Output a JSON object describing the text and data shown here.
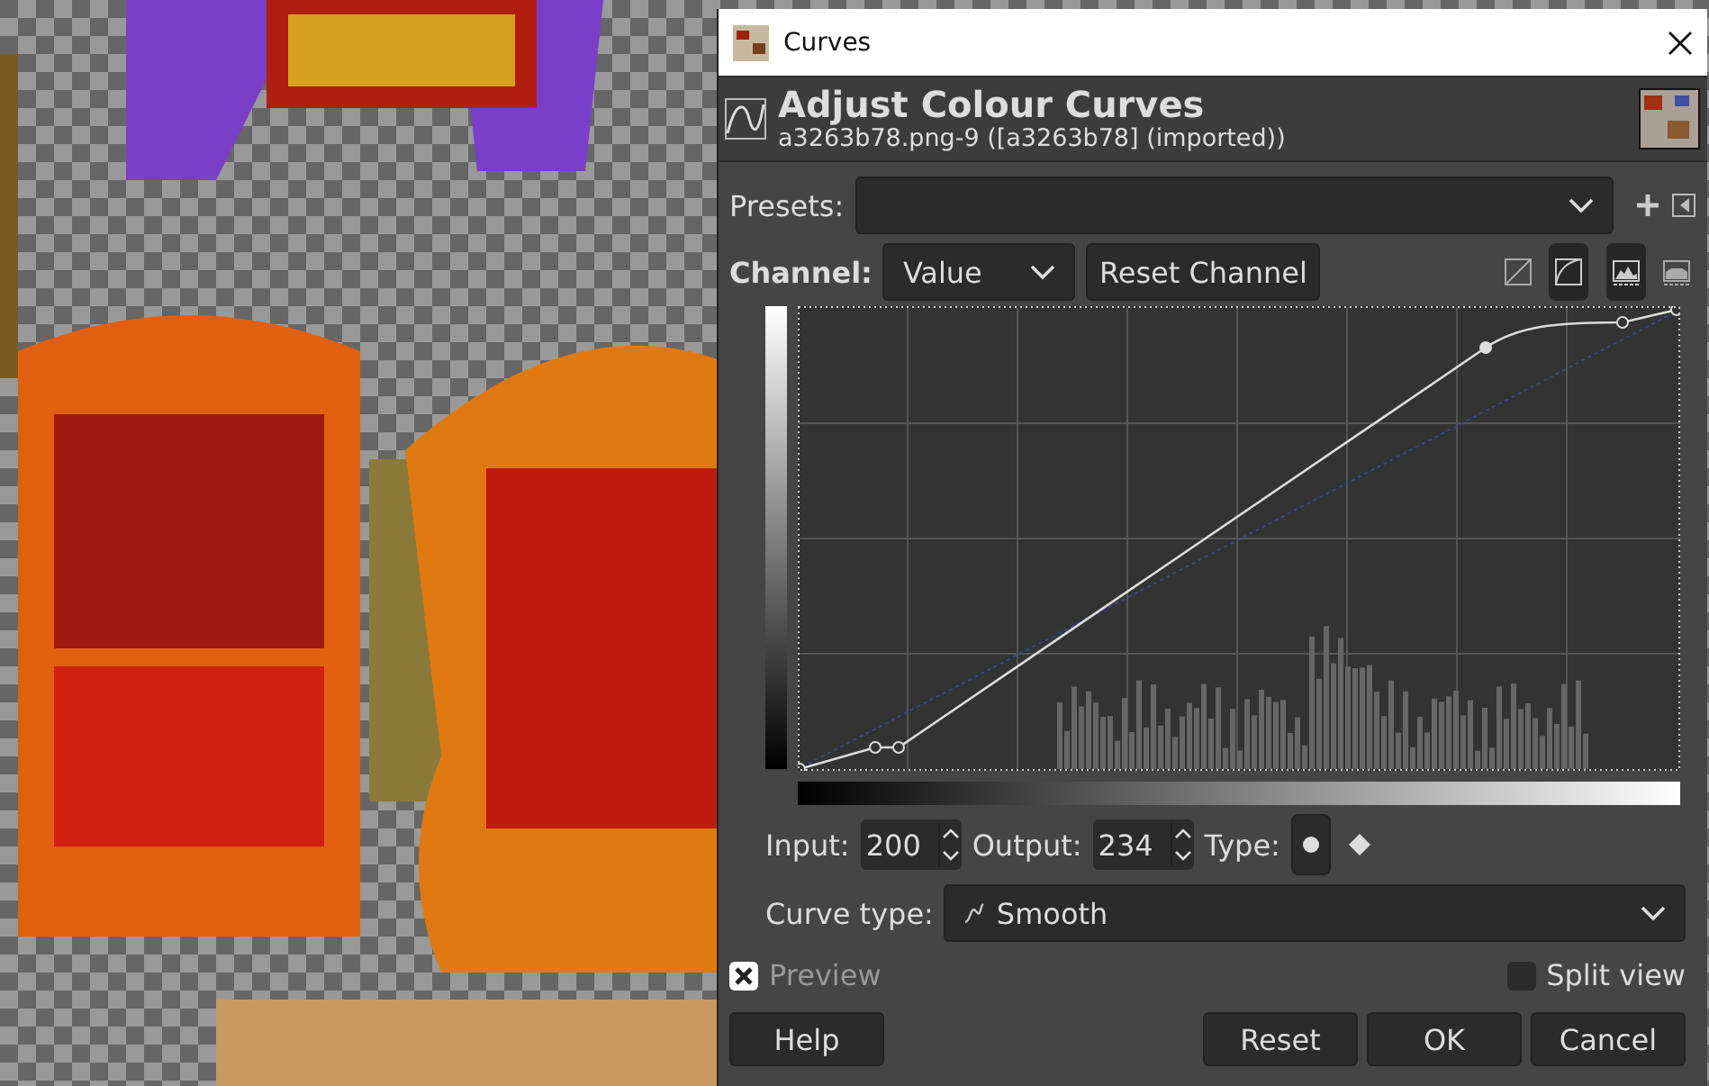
{
  "window": {
    "title": "Curves"
  },
  "header": {
    "title": "Adjust Colour Curves",
    "subtitle": "a3263b78.png-9 ([a3263b78] (imported))"
  },
  "presets": {
    "label": "Presets:"
  },
  "channel": {
    "label": "Channel:",
    "value": "Value",
    "reset_button": "Reset Channel"
  },
  "view_toggles": [
    {
      "kind": "linear",
      "selected": false
    },
    {
      "kind": "log",
      "selected": true
    },
    {
      "kind": "hist-linear",
      "selected": true
    },
    {
      "kind": "hist-log",
      "selected": false
    }
  ],
  "point": {
    "input_label": "Input:",
    "input": "200",
    "output_label": "Output:",
    "output": "234",
    "type_label": "Type:",
    "types": [
      {
        "kind": "smooth",
        "selected": true
      },
      {
        "kind": "corner",
        "selected": false
      }
    ]
  },
  "curve_type": {
    "label": "Curve type:",
    "value": "Smooth"
  },
  "preview": {
    "label": "Preview",
    "checked": true,
    "disabled": true
  },
  "split_view": {
    "label": "Split view",
    "checked": false
  },
  "buttons": [
    {
      "label": "Help",
      "kind": "left"
    },
    {
      "label": "Reset",
      "kind": "right"
    },
    {
      "label": "OK",
      "kind": "right"
    },
    {
      "label": "Cancel",
      "kind": "right"
    }
  ]
}
